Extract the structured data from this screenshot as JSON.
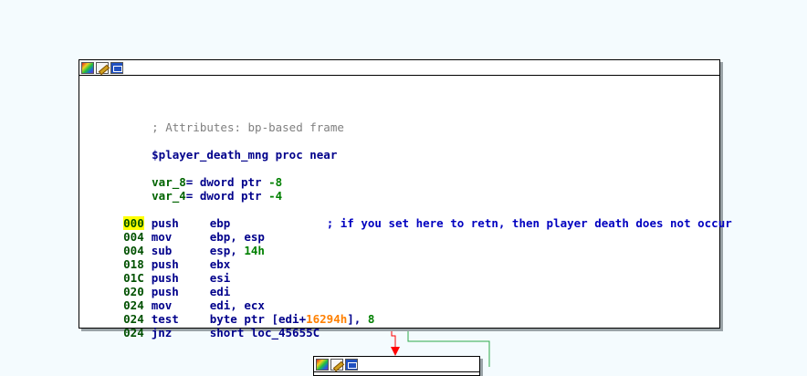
{
  "main_node": {
    "toolbar_icons": [
      "palette-icon",
      "pencil-icon",
      "graph-icon"
    ],
    "attributes_comment": "; Attributes: bp-based frame",
    "proc_decl": "$player_death_mng proc near",
    "vars": [
      {
        "name": "var_8",
        "rest": "= dword ptr ",
        "value": "-8"
      },
      {
        "name": "var_4",
        "rest": "= dword ptr ",
        "value": "-4"
      }
    ],
    "instructions": [
      {
        "sp": "000",
        "mnem": "push",
        "op1": "ebp",
        "comment": "; if you set here to retn, then player death does not occur"
      },
      {
        "sp": "004",
        "mnem": "mov",
        "op1": "ebp, esp"
      },
      {
        "sp": "004",
        "mnem": "sub",
        "op1": "esp, ",
        "num": "14h"
      },
      {
        "sp": "018",
        "mnem": "push",
        "op1": "ebx"
      },
      {
        "sp": "01C",
        "mnem": "push",
        "op1": "esi"
      },
      {
        "sp": "020",
        "mnem": "push",
        "op1": "edi"
      },
      {
        "sp": "024",
        "mnem": "mov",
        "op1": "edi, ecx"
      },
      {
        "sp": "024",
        "mnem": "test",
        "op1": "byte ptr [edi+",
        "hex": "16294h",
        "op2": "], ",
        "num2": "8"
      },
      {
        "sp": "024",
        "mnem": "jnz",
        "op1": "short loc_45655C"
      }
    ]
  },
  "next_node": {
    "toolbar_icons": [
      "palette-icon",
      "pencil-icon",
      "graph-icon"
    ]
  },
  "colors": {
    "background": "#f4fbfe",
    "edge_false": "#ff0000",
    "edge_true": "#2ea84a",
    "stack_highlight": "#ffff00"
  }
}
